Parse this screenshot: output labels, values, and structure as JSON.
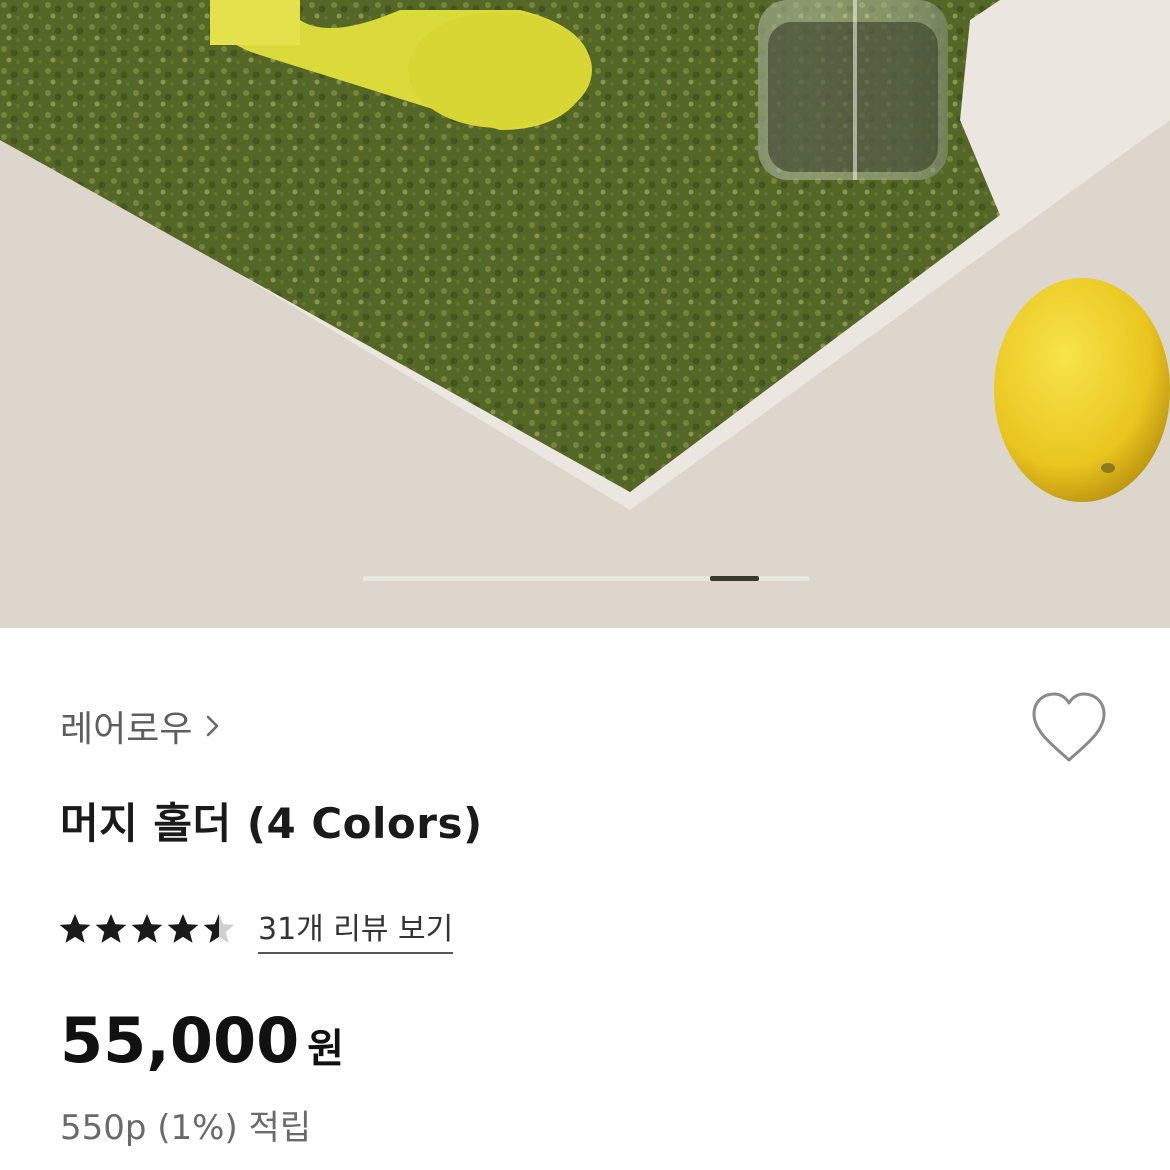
{
  "product": {
    "brand": "레어로우",
    "title": "머지 홀더 (4 Colors)",
    "rating": 4.5,
    "rating_max": 5,
    "review_link": "31개 리뷰 보기",
    "price": "55,000",
    "price_unit": "원",
    "points": "550p (1%) 적립"
  },
  "gallery": {
    "current_index": 8,
    "total": 9
  },
  "colors": {
    "star": "#1a1a1a",
    "star_empty": "#cfcfcf",
    "indicator_track": "#e9e6e2",
    "indicator_thumb": "#3a3734"
  },
  "icons": {
    "brand_chevron": "chevron-right-icon",
    "wish": "heart-outline-icon",
    "rating": "star-icon"
  }
}
